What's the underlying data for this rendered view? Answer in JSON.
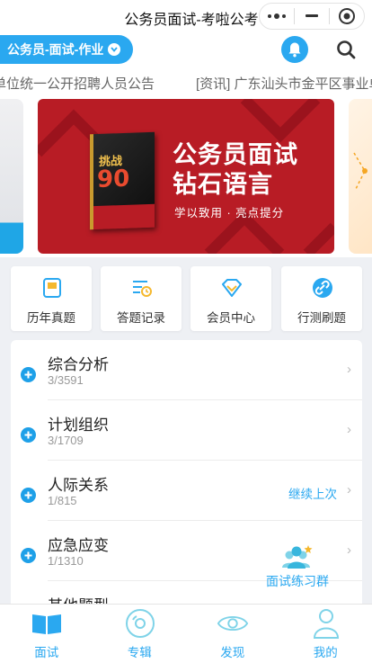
{
  "window": {
    "title": "公务员面试-考啦公考"
  },
  "header": {
    "exam_selector": "公务员-面试-作业"
  },
  "ticker": {
    "items": [
      "单位统一公开招聘人员公告",
      "[资讯] 广东汕头市金平区事业单"
    ]
  },
  "banner": {
    "book_title": "挑战",
    "book_number": "90",
    "headline_line1": "公务员面试",
    "headline_line2": "钻石语言",
    "subline": "学以致用 · 亮点提分"
  },
  "quick_links": [
    {
      "label": "历年真题",
      "icon": "book-icon"
    },
    {
      "label": "答题记录",
      "icon": "record-list-icon"
    },
    {
      "label": "会员中心",
      "icon": "diamond-icon"
    },
    {
      "label": "行测刷题",
      "icon": "link-icon"
    }
  ],
  "categories": [
    {
      "name": "综合分析",
      "progress": "3/3591",
      "action": ""
    },
    {
      "name": "计划组织",
      "progress": "3/1709",
      "action": ""
    },
    {
      "name": "人际关系",
      "progress": "1/815",
      "action": "继续上次"
    },
    {
      "name": "应急应变",
      "progress": "1/1310",
      "action": ""
    },
    {
      "name": "其他题型",
      "progress": "",
      "action": ""
    }
  ],
  "float_button": {
    "label": "面试练习群",
    "icon": "group-icon"
  },
  "tabbar": [
    {
      "label": "面试",
      "icon": "book-open-icon",
      "active": true
    },
    {
      "label": "专辑",
      "icon": "disc-icon",
      "active": false
    },
    {
      "label": "发现",
      "icon": "eye-icon",
      "active": false
    },
    {
      "label": "我的",
      "icon": "person-icon",
      "active": false
    }
  ],
  "colors": {
    "accent": "#2aa8f0",
    "banner_red": "#b81c25"
  }
}
